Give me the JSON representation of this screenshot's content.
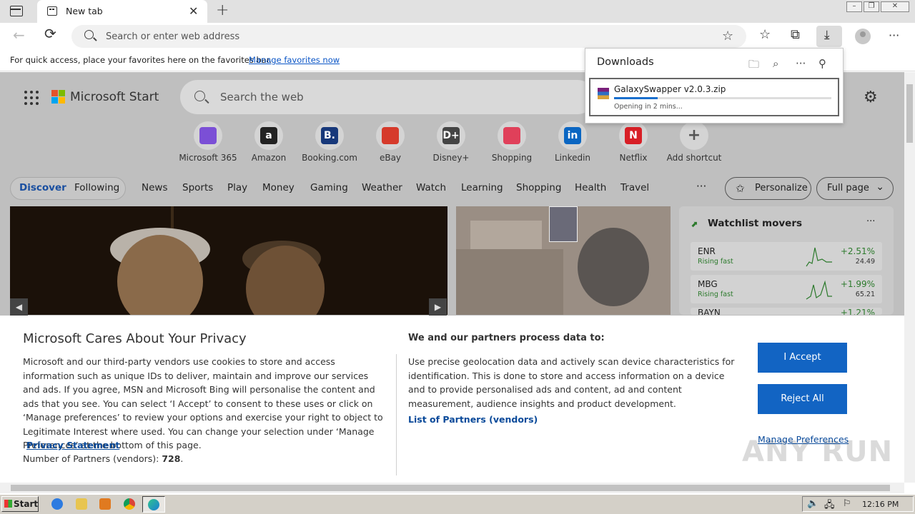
{
  "browser": {
    "tab_title": "New tab",
    "tab_close": "✕",
    "new_tab": "+",
    "address_placeholder": "Search or enter web address",
    "favorites_bar_text": "For quick access, place your favorites here on the favorites bar.",
    "favorites_bar_link": "Manage favorites now"
  },
  "downloads": {
    "title": "Downloads",
    "item": {
      "filename": "GalaxySwapper v2.0.3.zip",
      "status": "Opening in 2 mins...",
      "progress": 0.2
    }
  },
  "msn": {
    "brand": "Microsoft Start",
    "search_placeholder": "Search the web",
    "shortcuts": [
      {
        "label": "Microsoft 365",
        "glyph": "",
        "color": "#7b4fd6"
      },
      {
        "label": "Amazon",
        "glyph": "a",
        "color": "#222222"
      },
      {
        "label": "Booking.com",
        "glyph": "B.",
        "color": "#17387a"
      },
      {
        "label": "eBay",
        "glyph": "",
        "color": "#d63a2b"
      },
      {
        "label": "Disney+",
        "glyph": "D+",
        "color": "#444444"
      },
      {
        "label": "Shopping",
        "glyph": "",
        "color": "#e0405a"
      },
      {
        "label": "Linkedin",
        "glyph": "in",
        "color": "#0a66c2"
      },
      {
        "label": "Netflix",
        "glyph": "N",
        "color": "#d81f26"
      },
      {
        "label": "Add shortcut",
        "glyph": "+",
        "color": "#555555"
      }
    ],
    "discover": "Discover",
    "following": "Following",
    "nav": [
      "News",
      "Sports",
      "Play",
      "Money",
      "Gaming",
      "Weather",
      "Watch",
      "Learning",
      "Shopping",
      "Health",
      "Travel"
    ],
    "more": "···",
    "personalize": "Personalize",
    "full_page": "Full page",
    "watchlist": {
      "title": "Watchlist movers",
      "stocks": [
        {
          "symbol": "ENR",
          "status": "Rising fast",
          "change": "+2.51%",
          "price": "24.49"
        },
        {
          "symbol": "MBG",
          "status": "Rising fast",
          "change": "+1.99%",
          "price": "65.21"
        },
        {
          "symbol": "BAYN",
          "status": "",
          "change": "+1.21%",
          "price": ""
        }
      ]
    }
  },
  "privacy": {
    "title": "Microsoft Cares About Your Privacy",
    "body": "Microsoft and our third-party vendors use cookies to store and access information such as unique IDs to deliver, maintain and improve our services and ads. If you agree, MSN and Microsoft Bing will personalise the content and ads that you see. You can select ‘I Accept’ to consent to these uses or click on ‘Manage preferences’ to review your options and exercise your right to object to Legitimate Interest where used.  You can change your selection under ‘Manage Preferences’ at the bottom of this page.",
    "privacy_link": "Privacy Statement",
    "partners_label": "Number of Partners (vendors):",
    "partners_count": "728",
    "process_title": "We and our partners process data to:",
    "process_body": "Use precise geolocation data and actively scan device characteristics for identification. This is done to store and access information on a device and to provide personalised ads and content, ad and content measurement, audience insights and product development.",
    "list_partners": "List of Partners (vendors)",
    "accept": "I Accept",
    "reject": "Reject All",
    "manage": "Manage Preferences"
  },
  "watermark": "ANY RUN",
  "taskbar": {
    "start": "Start",
    "clock": "12:16 PM"
  }
}
